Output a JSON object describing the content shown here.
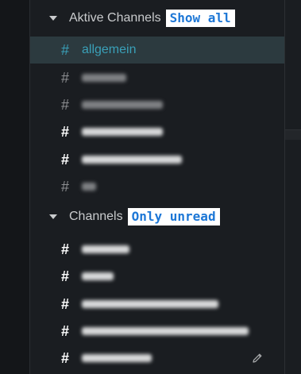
{
  "colors": {
    "background": "#1a1d21",
    "active_row": "#2c3a3f",
    "accent": "#3aa0b8",
    "badge_text": "#1d77d6",
    "badge_bg": "#ffffff"
  },
  "sections": {
    "active": {
      "title": "Aktive Channels",
      "badge": "Show all",
      "channels": [
        {
          "name": "allgemein",
          "active": true,
          "unread": false
        },
        {
          "name": "",
          "active": false,
          "unread": false,
          "obscured": true
        },
        {
          "name": "",
          "active": false,
          "unread": false,
          "obscured": true
        },
        {
          "name": "",
          "active": false,
          "unread": true,
          "obscured": true
        },
        {
          "name": "",
          "active": false,
          "unread": true,
          "obscured": true
        },
        {
          "name": "",
          "active": false,
          "unread": false,
          "obscured": true
        }
      ]
    },
    "channels": {
      "title": "Channels",
      "badge": "Only unread",
      "channels": [
        {
          "name": "",
          "unread": true,
          "obscured": true
        },
        {
          "name": "",
          "unread": true,
          "obscured": true
        },
        {
          "name": "",
          "unread": true,
          "obscured": true
        },
        {
          "name": "",
          "unread": true,
          "obscured": true
        },
        {
          "name": "",
          "unread": true,
          "obscured": true,
          "hover_icon": "pencil-icon"
        }
      ]
    }
  },
  "icons": {
    "hash": "#",
    "caret": "caret-down-icon",
    "edit": "pencil-icon"
  }
}
